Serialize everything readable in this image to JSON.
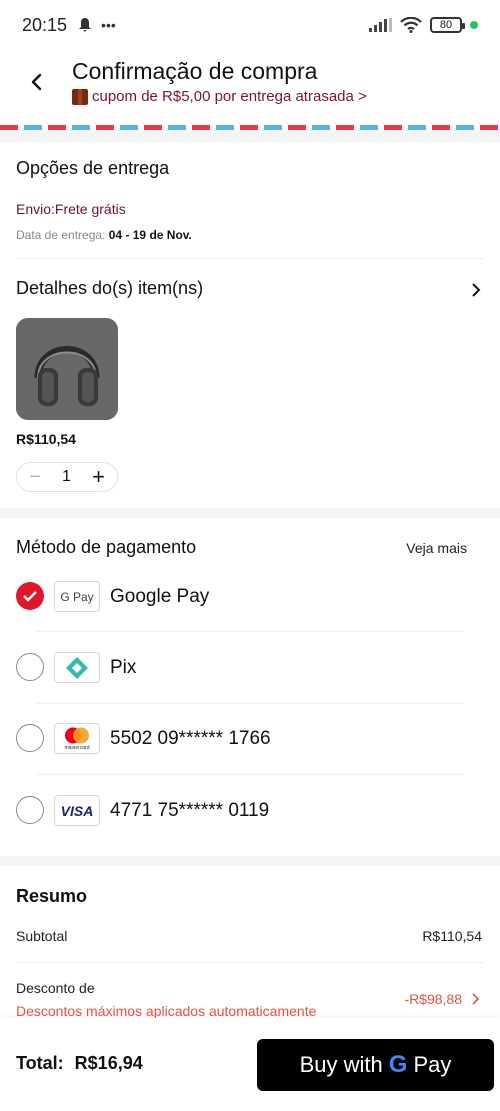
{
  "status_bar": {
    "time": "20:15",
    "battery": "80"
  },
  "header": {
    "title": "Confirmação de compra",
    "coupon": "cupom de R$5,00 por entrega atrasada >"
  },
  "delivery": {
    "title": "Opções de entrega",
    "shipping": "Envio:Frete grátis",
    "date_label": "Data de entrega:",
    "date_value": "04 - 19 de Nov."
  },
  "items": {
    "title": "Detalhes do(s) item(ns)",
    "price": "R$110,54",
    "quantity": "1",
    "minus": "−",
    "plus": "+"
  },
  "payment": {
    "title": "Método de pagamento",
    "see_more": "Veja mais",
    "options": [
      {
        "label": "Google Pay",
        "logo_text": "G Pay",
        "selected": true
      },
      {
        "label": "Pix",
        "selected": false
      },
      {
        "label": "5502 09****** 1766",
        "logo_text": "mastercard",
        "selected": false
      },
      {
        "label": "4771 75****** 0119",
        "logo_text": "VISA",
        "selected": false
      }
    ]
  },
  "summary": {
    "title": "Resumo",
    "subtotal_label": "Subtotal",
    "subtotal_value": "R$110,54",
    "discount_label": "Desconto de",
    "discount_sub": "Descontos máximos aplicados automaticamente",
    "discount_value": "-R$98,88"
  },
  "bottom": {
    "total_label": "Total:",
    "total_value": "R$16,94",
    "button_prefix": "Buy with",
    "button_g": "G",
    "button_pay": "Pay"
  },
  "colors": {
    "accent_red": "#e1162a",
    "discount": "#e2553f",
    "coupon": "#7a1530"
  }
}
